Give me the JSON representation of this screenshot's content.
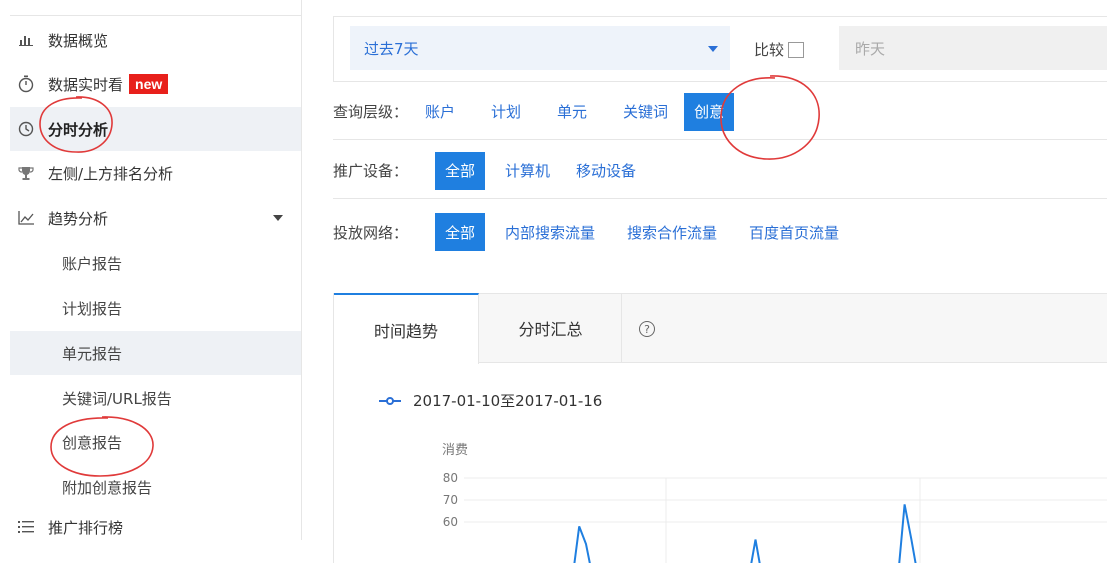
{
  "sidebar": {
    "items": [
      {
        "label": "数据概览",
        "icon": "bar-chart-icon"
      },
      {
        "label": "数据实时看",
        "icon": "stopwatch-icon",
        "badge": "new"
      },
      {
        "label": "分时分析",
        "icon": "clock-icon"
      },
      {
        "label": "左侧/上方排名分析",
        "icon": "trophy-icon"
      },
      {
        "label": "趋势分析",
        "icon": "trend-chart-icon"
      },
      {
        "label": "账户报告"
      },
      {
        "label": "计划报告"
      },
      {
        "label": "单元报告"
      },
      {
        "label": "关键词/URL报告"
      },
      {
        "label": "创意报告"
      },
      {
        "label": "附加创意报告"
      },
      {
        "label": "推广排行榜",
        "icon": "list-icon"
      }
    ]
  },
  "topbar": {
    "date_range": "过去7天",
    "compare_label": "比较",
    "compare_value": "昨天"
  },
  "filters": {
    "level": {
      "label": "查询层级：",
      "options": [
        "账户",
        "计划",
        "单元",
        "关键词",
        "创意"
      ],
      "selected": "创意"
    },
    "device": {
      "label": "推广设备：",
      "options": [
        "全部",
        "计算机",
        "移动设备"
      ],
      "selected": "全部"
    },
    "network": {
      "label": "投放网络：",
      "options": [
        "全部",
        "内部搜索流量",
        "搜索合作流量",
        "百度首页流量"
      ],
      "selected": "全部"
    }
  },
  "tabs": [
    {
      "label": "时间趋势"
    },
    {
      "label": "分时汇总"
    }
  ],
  "help_glyph": "?",
  "legend": {
    "label": "2017-01-10至2017-01-16"
  },
  "chart_data": {
    "type": "line",
    "ylabel": "消费",
    "yticks": [
      "80",
      "70",
      "60"
    ],
    "ylim": [
      50,
      80
    ],
    "series": [
      {
        "values": [
          0,
          0,
          0,
          0,
          0,
          0,
          0,
          0,
          0,
          0,
          0,
          0,
          0,
          0,
          0,
          0,
          0,
          58,
          50,
          0,
          0,
          0,
          0,
          0,
          0,
          0,
          0,
          0,
          0,
          0,
          0,
          0,
          0,
          0,
          0,
          0,
          0,
          0,
          0,
          0,
          0,
          0,
          0,
          52,
          0,
          0,
          0,
          0,
          0,
          0,
          0,
          0,
          0,
          0,
          0,
          0,
          0,
          0,
          0,
          0,
          0,
          0,
          0,
          0,
          0,
          68,
          52,
          0,
          0,
          0,
          0,
          0,
          0,
          0,
          0,
          0,
          0,
          0,
          0,
          0,
          0,
          0,
          0,
          0,
          0,
          0,
          0,
          0,
          0,
          0,
          0,
          0,
          0,
          0,
          0,
          0
        ]
      }
    ],
    "color": "#1f7fe0"
  },
  "colors": {
    "accent": "#1f7fe0",
    "badge": "#e8201b",
    "annotation": "#e03a3a"
  }
}
